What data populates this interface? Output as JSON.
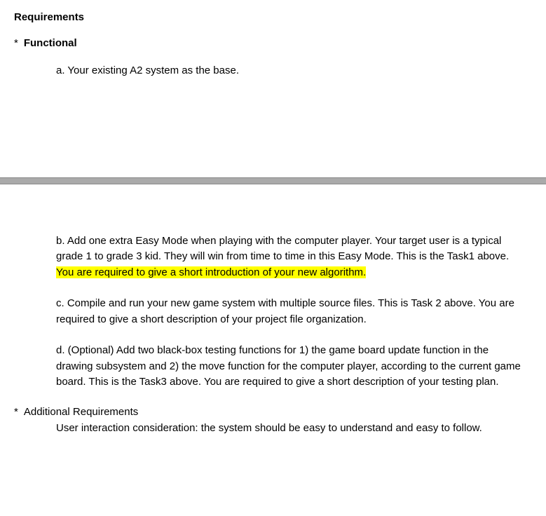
{
  "heading": "Requirements",
  "functional_label": "Functional",
  "item_a": "a. Your existing A2 system as the base.",
  "item_b_prefix": "b. Add one extra Easy Mode when playing with the computer player. Your target user is a typical grade 1 to grade 3 kid. They will win from time to time in this Easy Mode. This is the Task1 above. ",
  "item_b_highlight": "You are required to give a short introduction of your new algorithm.",
  "item_c": "c. Compile and run your new game system with multiple source files. This is Task 2 above. You are required to give a short description of your project file organization.",
  "item_d": "d. (Optional) Add two black-box testing functions for 1) the game board update function in the drawing subsystem and 2) the move function for the computer player, according to the current game board. This is the Task3 above. You are required to give a short description of your testing plan.",
  "additional_label": "Additional Requirements",
  "additional_text": "User interaction consideration: the system should be easy to understand and easy to follow."
}
